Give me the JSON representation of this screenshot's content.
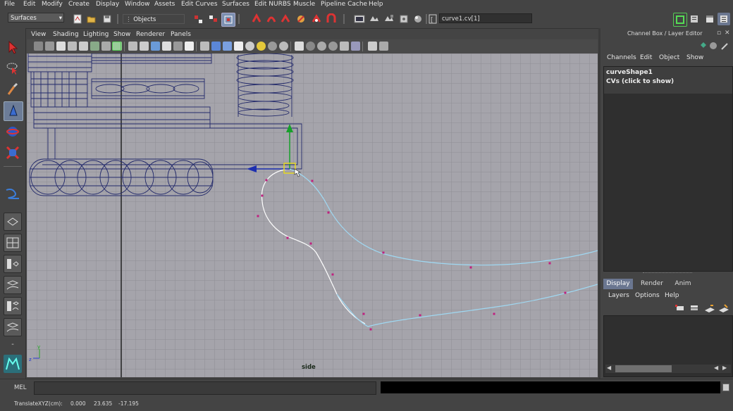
{
  "menubar": {
    "items": [
      "File",
      "Edit",
      "Modify",
      "Create",
      "Display",
      "Window",
      "Assets",
      "Edit Curves",
      "Surfaces",
      "Edit NURBS",
      "Muscle",
      "Pipeline Cache",
      "Help"
    ]
  },
  "statusline": {
    "menuset": "Surfaces",
    "selection_mode": "Objects",
    "input_field": "curve1.cv[1]"
  },
  "panel": {
    "menu": [
      "View",
      "Shading",
      "Lighting",
      "Show",
      "Renderer",
      "Panels"
    ],
    "camera_label": "side",
    "curve_color": "#9fd8f2",
    "cv_color": "#c0207f",
    "grid_bg": "#a5a4ab"
  },
  "channel_box": {
    "title": "Channel Box / Layer Editor",
    "menu": [
      "Channels",
      "Edit",
      "Object",
      "Show"
    ],
    "object_name": "curveShape1",
    "cvs_label": "CVs (click to show)"
  },
  "layer_editor": {
    "tabs": [
      "Display",
      "Render",
      "Anim"
    ],
    "active_tab": "Display",
    "menu": [
      "Layers",
      "Options",
      "Help"
    ]
  },
  "command_line": {
    "label": "MEL",
    "value": ""
  },
  "help_line": {
    "label": "TranslateXYZ(cm):",
    "x": "0.000",
    "y": "23.635",
    "z": "-17.195"
  },
  "icons": [
    "select-tool-icon",
    "lasso-tool-icon",
    "paint-select-icon",
    "move-tool-icon",
    "rotate-tool-icon",
    "scale-tool-icon",
    "curve-tool-icon",
    "layout-single-icon",
    "layout-four-icon",
    "layout-outliner-icon"
  ]
}
